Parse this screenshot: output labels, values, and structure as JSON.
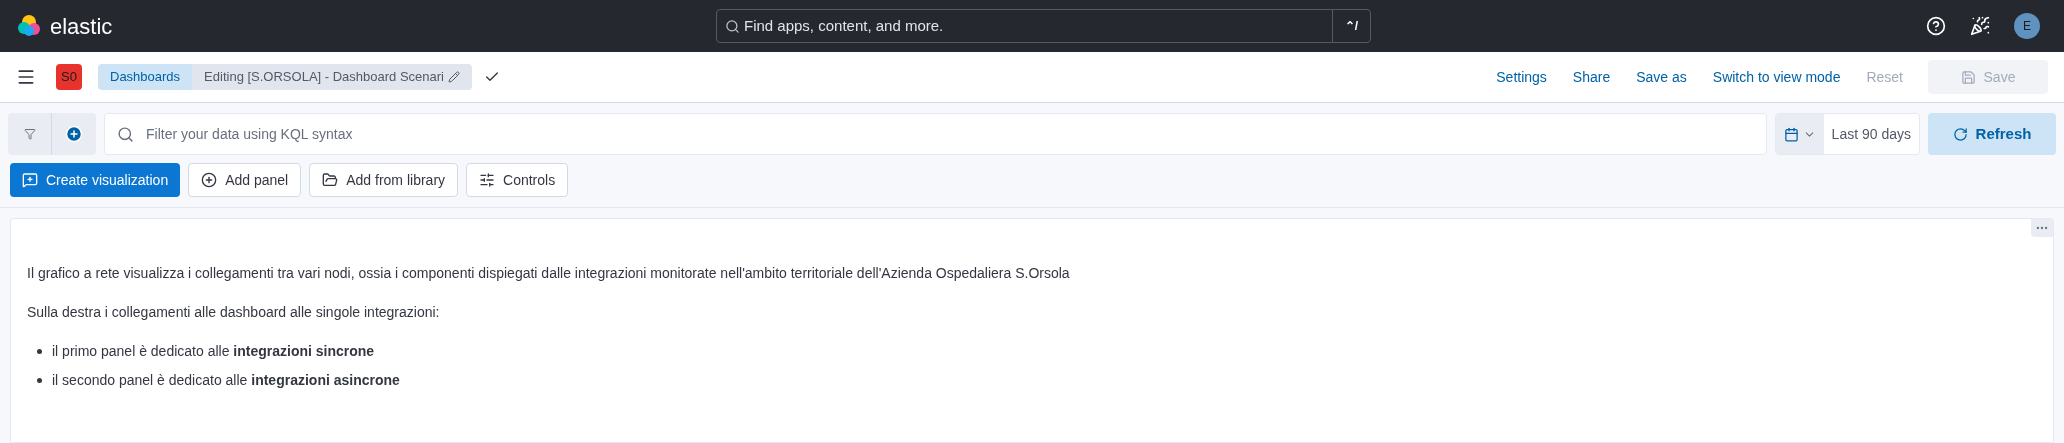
{
  "header": {
    "brand": "elastic",
    "search": {
      "placeholder": "Find apps, content, and more.",
      "shortcut": "⌃/"
    },
    "avatar": "E"
  },
  "app_bar": {
    "space_badge": "S0",
    "breadcrumbs": [
      {
        "label": "Dashboards",
        "selected": false
      },
      {
        "label": "Editing [S.ORSOLA] - Dashboard Scenari",
        "selected": true
      }
    ],
    "actions": [
      {
        "label": "Settings",
        "disabled": false
      },
      {
        "label": "Share",
        "disabled": false
      },
      {
        "label": "Save as",
        "disabled": false
      },
      {
        "label": "Switch to view mode",
        "disabled": false
      },
      {
        "label": "Reset",
        "disabled": true
      }
    ],
    "save": {
      "label": "Save",
      "disabled": true
    }
  },
  "query_bar": {
    "placeholder": "Filter your data using KQL syntax",
    "time_range": "Last 90 days",
    "refresh": "Refresh"
  },
  "toolbar": [
    {
      "label": "Create visualization",
      "kind": "primary"
    },
    {
      "label": "Add panel",
      "kind": "plus"
    },
    {
      "label": "Add from library",
      "kind": "folder"
    },
    {
      "label": "Controls",
      "kind": "sliders"
    }
  ],
  "panel": {
    "paragraphs": [
      "Il grafico a rete visualizza i collegamenti tra vari nodi, ossia i componenti dispiegati dalle integrazioni monitorate nell'ambito territoriale dell'Azienda Ospedaliera S.Orsola",
      "Sulla destra i collegamenti alle dashboard alle singole integrazioni:"
    ],
    "bullets": [
      "il primo panel è dedicato alle **integrazioni sincrone**",
      "il secondo panel è dedicato alle **integrazioni asincrone**"
    ]
  }
}
